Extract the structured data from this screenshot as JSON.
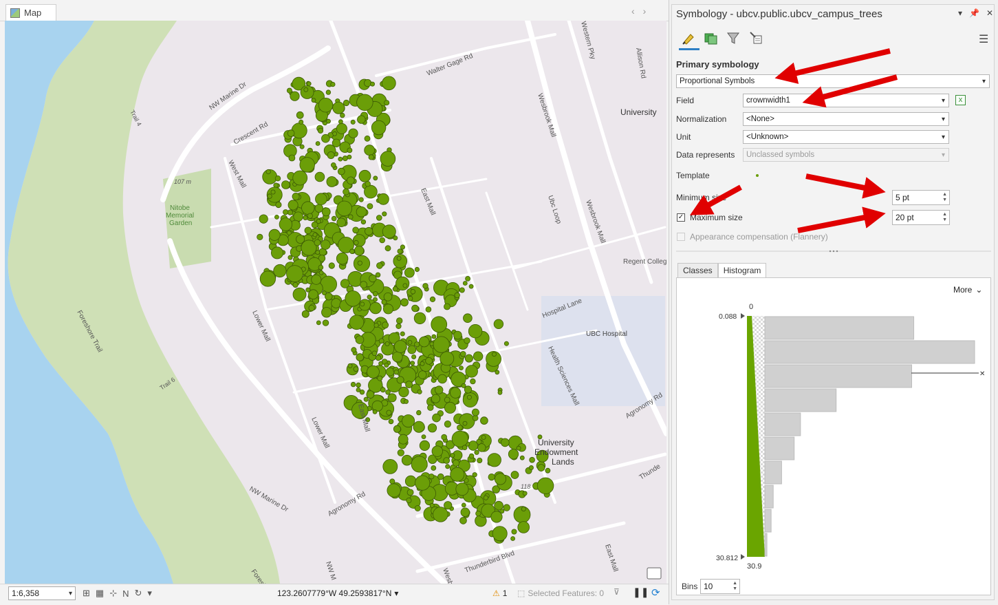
{
  "map_tab": {
    "label": "Map"
  },
  "map_labels": {
    "nw_marine_top": "NW Marine Dr",
    "walter_gage": "Walter Gage Rd",
    "crescent": "Crescent Rd",
    "west_mall": "West Mall",
    "trail4": "Trail 4",
    "elev107": "107 m",
    "nitobe1": "Nitobe",
    "nitobe2": "Memorial",
    "nitobe3": "Garden",
    "university": "University",
    "allison": "Allison Rd",
    "western_pky": "Western Pky",
    "wesbrook_mall1": "Wesbrook Mall",
    "wesbrook_mall2": "Wesbrook Mall",
    "ubc_loop": "Ubc Loop",
    "east_mall1": "East Mall",
    "regent": "Regent Colleg",
    "hospital_lane": "Hospital Lane",
    "ubc_hospital": "UBC Hospital",
    "health_sciences": "Health Sciences Mall",
    "agronomy_right": "Agronomy Rd",
    "lower_mall1": "Lower Mall",
    "lower_mall2": "Lower Mall",
    "east_mall2": "East Mall",
    "foreshore_trail": "Foreshore Trail",
    "trail6": "Trail 6",
    "univ_end1": "University",
    "univ_end2": "Endowment",
    "univ_end3": "Lands",
    "elev118": "118",
    "nw_marine_bottom": "NW Marine Dr",
    "agronomy_left": "Agronomy Rd",
    "thunderbird": "Thunderbird Blvd",
    "east_mall3": "East Mall",
    "nw_m_bottom": "NW M",
    "foreshore_bottom": "Foresho",
    "wesb_bottom": "Wesb",
    "thunde": "Thunde"
  },
  "status_bar": {
    "scale": "1:6,358",
    "coordinates": "123.2607779°W 49.2593817°N",
    "warning_count": "1",
    "selected_features": "Selected Features: 0"
  },
  "symbology": {
    "title": "Symbology - ubcv.public.ubcv_campus_trees",
    "section_heading": "Primary symbology",
    "method": "Proportional Symbols",
    "field_label": "Field",
    "field_value": "crownwidth1",
    "normalization_label": "Normalization",
    "normalization_value": "<None>",
    "unit_label": "Unit",
    "unit_value": "<Unknown>",
    "data_represents_label": "Data represents",
    "data_represents_value": "Unclassed symbols",
    "template_label": "Template",
    "minimum_label": "Minimum size",
    "minimum_value": "5 pt",
    "maximum_label": "Maximum size",
    "maximum_value": "20 pt",
    "maximum_checked": true,
    "appearance_label": "Appearance compensation (Flannery)",
    "tabs": [
      "Classes",
      "Histogram"
    ],
    "active_tab": "Histogram",
    "more_label": "More",
    "bins_label": "Bins",
    "bins_value": "10"
  },
  "histogram": {
    "top_value_label": "0",
    "min_label": "0.088",
    "max_label": "30.812",
    "bottom_value_label": "30.9",
    "bin_counts_relative": [
      0.71,
      1.0,
      0.7,
      0.34,
      0.17,
      0.14,
      0.08,
      0.04,
      0.03,
      0.01
    ],
    "ramp_color": "#6aa500",
    "bar_color": "#d0d0d0"
  },
  "colors": {
    "tree_fill": "#6b9e08",
    "tree_stroke": "#3c5a05",
    "water": "#a8d3ef",
    "forest": "#cfe0b6",
    "land": "#ece7ec",
    "road": "#ffffff",
    "accent": "#2c7fc5",
    "annotation_arrow": "#e00000"
  }
}
